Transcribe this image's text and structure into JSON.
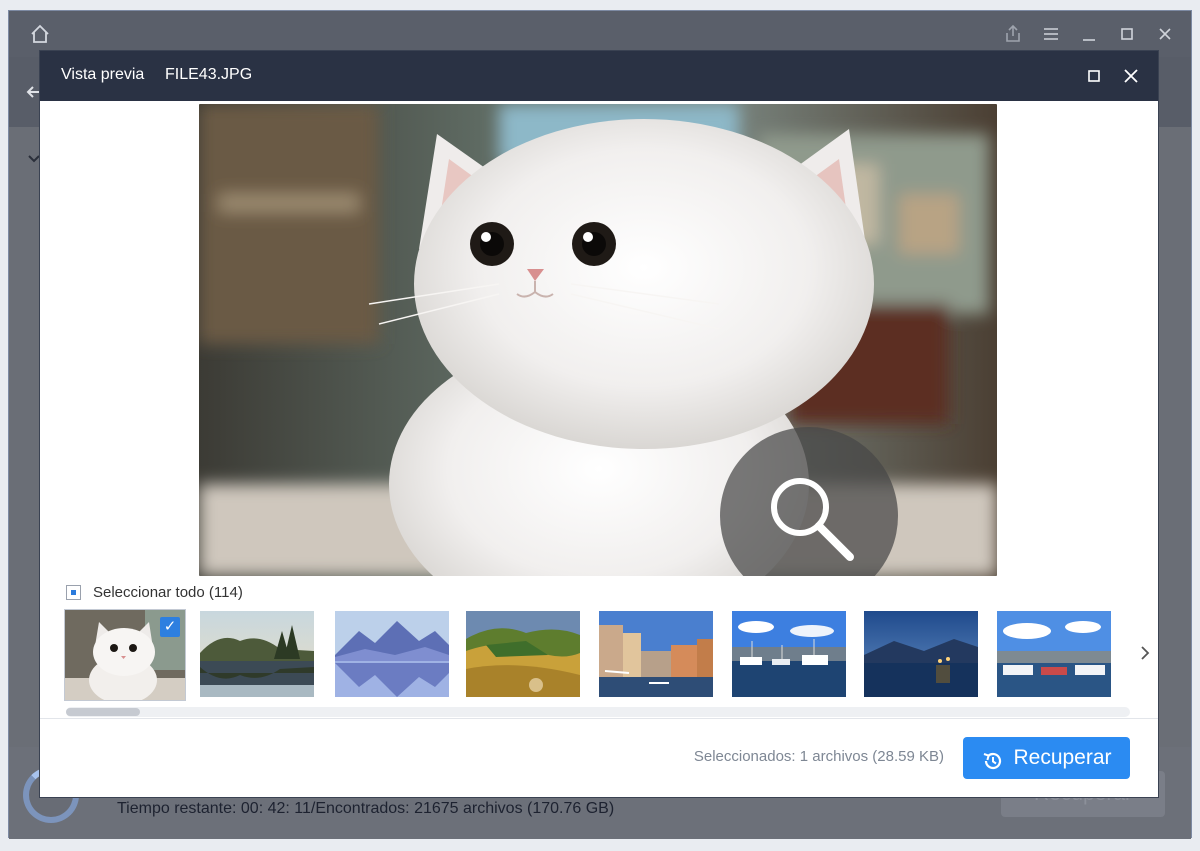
{
  "background": {
    "icons": [
      "home-icon",
      "share-icon",
      "menu-icon",
      "minimize-icon",
      "maximize-icon",
      "close-icon",
      "back-arrow-icon",
      "search-icon",
      "chevron-down-icon"
    ],
    "footer_status": "Tiempo restante: 00: 42: 11/Encontrados: 21675 archivos (170.76 GB)",
    "recover_label": "Recuperar"
  },
  "dialog": {
    "title": "Vista previa",
    "filename": "FILE43.JPG",
    "maximize_icon": "maximize-icon",
    "close_icon": "close-icon",
    "zoom_icon": "zoom-search-icon"
  },
  "thumbnails": {
    "select_all_label": "Seleccionar todo (114)",
    "items": [
      {
        "scene": "white-kitten",
        "selected": true
      },
      {
        "scene": "lake-trees-reflection",
        "selected": false
      },
      {
        "scene": "blue-mountains-lake",
        "selected": false
      },
      {
        "scene": "golden-hills-hay-bale",
        "selected": false
      },
      {
        "scene": "venice-canal",
        "selected": false
      },
      {
        "scene": "harbor-boats-day",
        "selected": false
      },
      {
        "scene": "lake-town-dusk",
        "selected": false
      },
      {
        "scene": "harbor-boats-clouds",
        "selected": false
      }
    ],
    "next_icon": "chevron-right-icon"
  },
  "footer": {
    "selection_status": "Seleccionados: 1 archivos (28.59 KB)",
    "recover_label": "Recuperar",
    "recover_icon": "history-icon",
    "accent_color": "#2b8bf2"
  }
}
